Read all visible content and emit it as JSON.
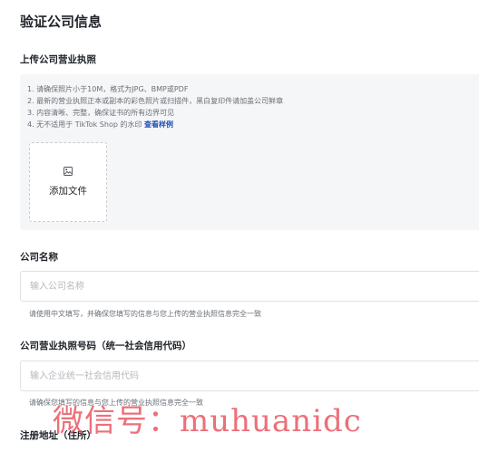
{
  "page": {
    "title": "验证公司信息"
  },
  "license_upload": {
    "label": "上传公司营业执照",
    "requirements": [
      "1. 请确保照片小于10M，格式为JPG、BMP或PDF",
      "2. 最新的营业执照正本或副本的彩色照片或扫描件，黑白复印件请加盖公司鲜章",
      "3. 内容清晰、完整，确保证书的所有边界可见",
      "4. 无不适用于 TikTok Shop 的水印 "
    ],
    "example_link": "查看样例",
    "add_file_label": "添加文件",
    "add_file_icon": "image-upload-icon"
  },
  "company_name": {
    "label": "公司名称",
    "placeholder": "输入公司名称",
    "value": "",
    "hint": "请使用中文填写，并确保您填写的信息与您上传的营业执照信息完全一致"
  },
  "license_number": {
    "label": "公司营业执照号码（统一社会信用代码）",
    "placeholder": "输入企业统一社会信用代码",
    "value": "",
    "hint": "请确保您填写的信息与您上传的营业执照信息完全一致"
  },
  "address": {
    "label": "注册地址（住所）"
  },
  "watermark": {
    "text": "微信号：muhuanidc"
  }
}
